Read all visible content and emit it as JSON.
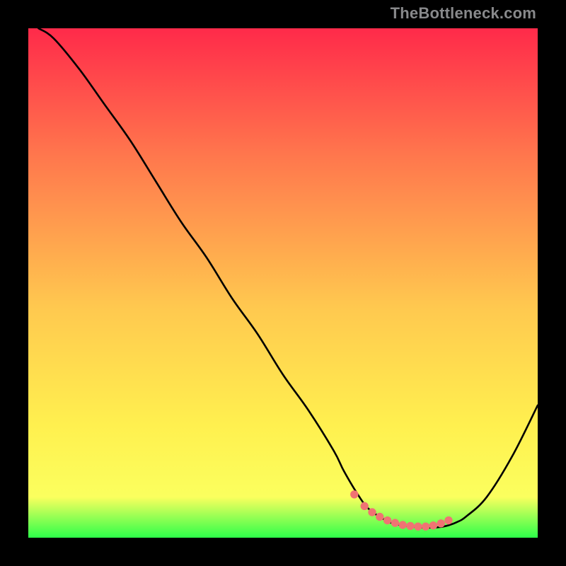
{
  "watermark": "TheBottleneck.com",
  "colors": {
    "background": "#000000",
    "gradient_top": "#ff2a4a",
    "gradient_mid1": "#ff774d",
    "gradient_mid2": "#ffc94f",
    "gradient_mid3": "#fff04f",
    "gradient_mid4": "#fbff5e",
    "gradient_bottom": "#2dff4a",
    "curve": "#000000",
    "marker_fill": "#f07373",
    "marker_stroke": "#f07373",
    "watermark": "#88898b"
  },
  "chart_data": {
    "type": "line",
    "title": "",
    "xlabel": "",
    "ylabel": "",
    "xlim": [
      0,
      100
    ],
    "ylim": [
      0,
      100
    ],
    "series": [
      {
        "name": "bottleneck-curve",
        "x": [
          2,
          5,
          10,
          15,
          20,
          25,
          30,
          35,
          40,
          45,
          50,
          55,
          60,
          62,
          65,
          67,
          70,
          72,
          75,
          77,
          80,
          82,
          84,
          86,
          90,
          95,
          100
        ],
        "y": [
          100,
          98,
          92,
          85,
          78,
          70,
          62,
          55,
          47,
          40,
          32,
          25,
          17,
          13,
          8,
          5.5,
          3.5,
          2.7,
          2.2,
          2.0,
          2.0,
          2.3,
          3.0,
          4.2,
          8,
          16,
          26
        ]
      }
    ],
    "markers": {
      "name": "optimal-zone",
      "x": [
        64,
        66,
        67.5,
        69,
        70.5,
        72,
        73.5,
        75,
        76.5,
        78,
        79.5,
        81,
        82.5
      ],
      "y": [
        8.5,
        6.2,
        5.0,
        4.1,
        3.4,
        2.9,
        2.5,
        2.3,
        2.2,
        2.2,
        2.4,
        2.8,
        3.4
      ]
    }
  }
}
